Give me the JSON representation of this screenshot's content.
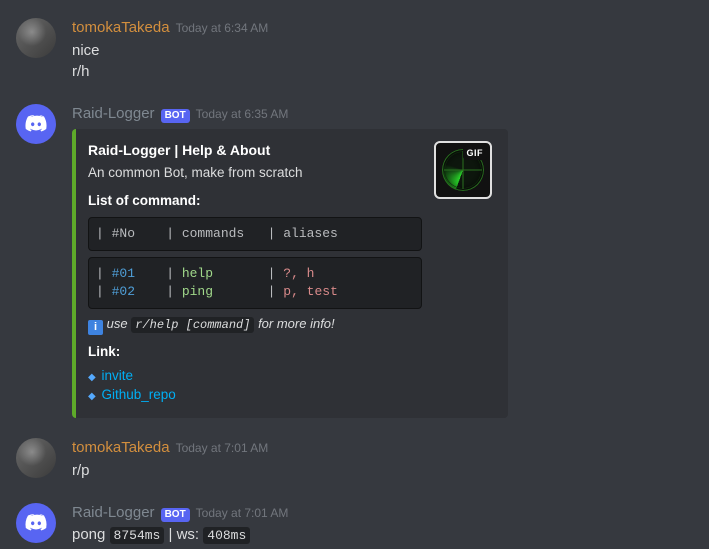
{
  "messages": [
    {
      "author": "tomokaTakeda",
      "author_type": "user",
      "timestamp": "Today at 6:34 AM",
      "lines": [
        "nice",
        "r/h"
      ]
    },
    {
      "author": "Raid-Logger",
      "author_type": "bot",
      "bot_tag": "BOT",
      "timestamp": "Today at 6:35 AM",
      "embed": {
        "title": "Raid-Logger | Help & About",
        "description": "An common Bot, make from scratch",
        "commands_heading": "List of command:",
        "table_header": "| #No    | commands   | aliases            |",
        "table_rows": [
          {
            "no": "#01",
            "cmd": "help",
            "alias": "?, h"
          },
          {
            "no": "#02",
            "cmd": "ping",
            "alias": "p, test"
          }
        ],
        "hint_prefix": "use",
        "hint_code": "r/help [command]",
        "hint_suffix": "for more info!",
        "link_heading": "Link:",
        "links": [
          "invite",
          "Github_repo"
        ],
        "thumb_tag": "GIF"
      }
    },
    {
      "author": "tomokaTakeda",
      "author_type": "user",
      "timestamp": "Today at 7:01 AM",
      "lines": [
        "r/p"
      ]
    },
    {
      "author": "Raid-Logger",
      "author_type": "bot",
      "bot_tag": "BOT",
      "timestamp": "Today at 7:01 AM",
      "pong": {
        "text": "pong",
        "lat1": "8754ms",
        "sep": "| ws:",
        "lat2": "408ms"
      }
    }
  ]
}
